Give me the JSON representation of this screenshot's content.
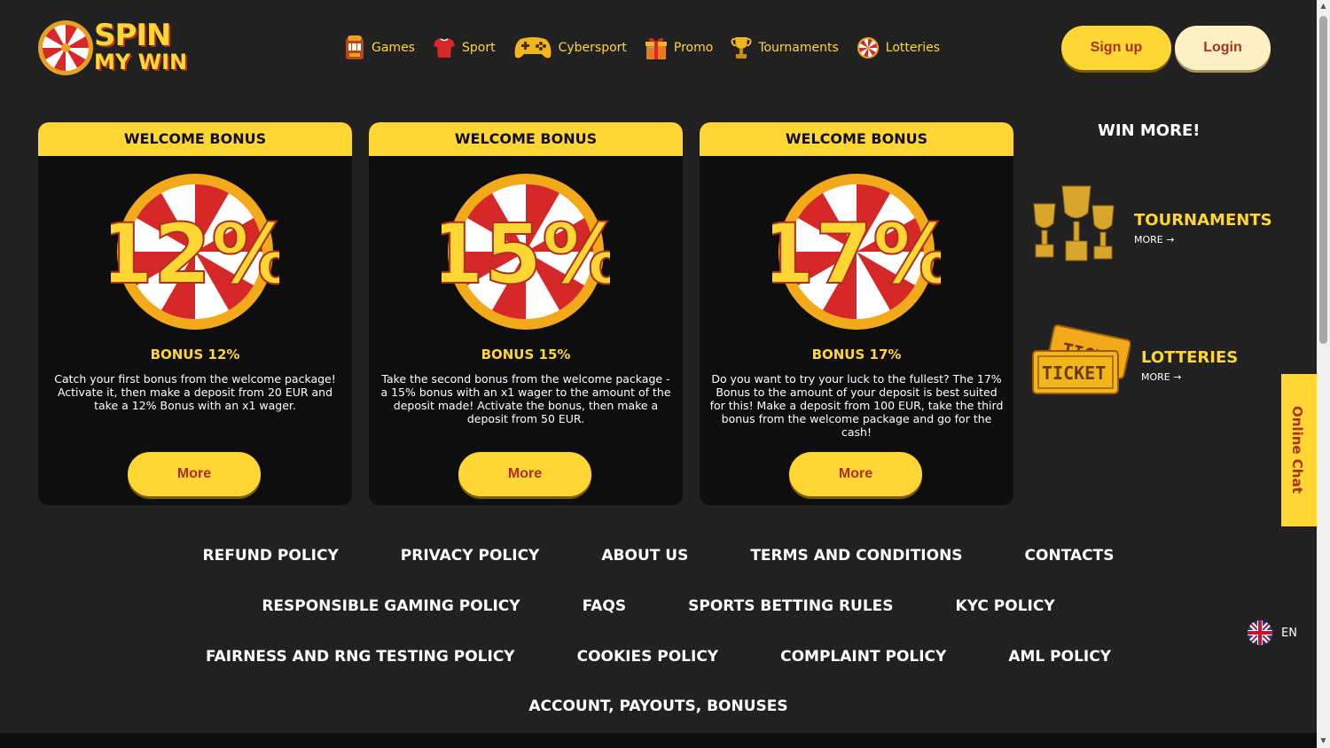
{
  "brand": {
    "logo_line1": "SPIN",
    "logo_line2": "MY WIN",
    "accent": "#ffd633",
    "dark_red": "#a8321b"
  },
  "nav": {
    "items": [
      {
        "label": "Games",
        "icon": "slot-machine-icon"
      },
      {
        "label": "Sport",
        "icon": "jersey-icon"
      },
      {
        "label": "Cybersport",
        "icon": "gamepad-icon"
      },
      {
        "label": "Promo",
        "icon": "gift-icon"
      },
      {
        "label": "Tournaments",
        "icon": "trophy-icon"
      },
      {
        "label": "Lotteries",
        "icon": "wheel-icon"
      }
    ]
  },
  "auth": {
    "signup_label": "Sign up",
    "login_label": "Login"
  },
  "bonus_cards": [
    {
      "header": "WELCOME BONUS",
      "percent": "12%",
      "title": "BONUS 12%",
      "description": "Catch your first bonus from the welcome package! Activate it, then make a deposit from 20 EUR and take a 12% Bonus with an x1 wager.",
      "button": "More"
    },
    {
      "header": "WELCOME BONUS",
      "percent": "15%",
      "title": "BONUS 15%",
      "description": "Take the second bonus from the welcome package - a 15% bonus with an x1 wager to the amount of the deposit made! Activate the bonus, then make a deposit from 50 EUR.",
      "button": "More"
    },
    {
      "header": "WELCOME BONUS",
      "percent": "17%",
      "title": "BONUS 17%",
      "description": "Do you want to try your luck to the fullest? The 17% Bonus to the amount of your deposit is best suited for this! Make a deposit from 100 EUR, take the third bonus from the welcome package and go for the cash!",
      "button": "More"
    }
  ],
  "win_more": {
    "title": "WIN MORE!",
    "items": [
      {
        "label": "TOURNAMENTS",
        "more": "MORE",
        "icon": "trophies-icon"
      },
      {
        "label": "LOTTERIES",
        "more": "MORE",
        "icon": "tickets-icon"
      }
    ]
  },
  "footer": {
    "rows": [
      [
        "REFUND POLICY",
        "PRIVACY POLICY",
        "ABOUT US",
        "TERMS AND CONDITIONS",
        "CONTACTS"
      ],
      [
        "RESPONSIBLE GAMING POLICY",
        "FAQS",
        "SPORTS BETTING RULES",
        "KYC POLICY"
      ],
      [
        "FAIRNESS AND RNG TESTING POLICY",
        "COOKIES POLICY",
        "COMPLAINT POLICY",
        "AML POLICY"
      ],
      [
        "ACCOUNT, PAYOUTS, BONUSES"
      ]
    ]
  },
  "chat": {
    "label": "Online Chat"
  },
  "language": {
    "code": "EN",
    "icon": "uk-flag-icon"
  }
}
